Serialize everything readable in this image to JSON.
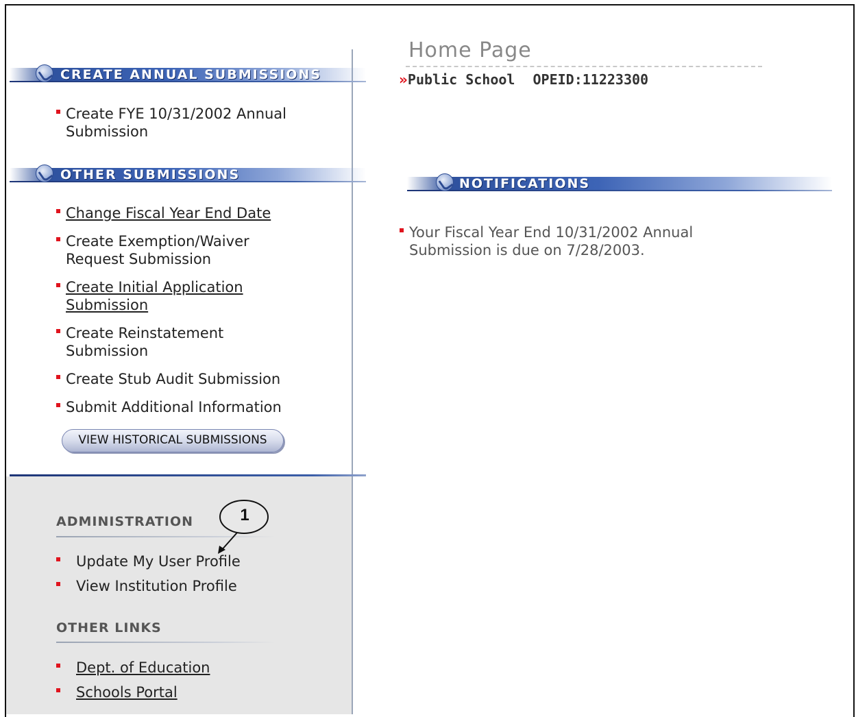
{
  "sidebar": {
    "create_annual": {
      "title": "CREATE ANNUAL SUBMISSIONS",
      "items": [
        {
          "line1": "Create FYE 10/31/2002 Annual",
          "line2": "Submission"
        }
      ]
    },
    "other_submissions": {
      "title": "OTHER SUBMISSIONS",
      "items": [
        {
          "line1": "Change Fiscal Year End Date",
          "line2": ""
        },
        {
          "line1": "Create Exemption/Waiver",
          "line2": "Request Submission"
        },
        {
          "line1": "Create Initial Application",
          "line2": "Submission"
        },
        {
          "line1": "Create Reinstatement",
          "line2": "Submission"
        },
        {
          "line1": "Create Stub Audit Submission",
          "line2": ""
        },
        {
          "line1": "Submit Additional Information",
          "line2": ""
        }
      ],
      "history_button": "VIEW HISTORICAL SUBMISSIONS"
    },
    "administration": {
      "title": "ADMINISTRATION",
      "items": [
        "Update My User Profile",
        "View Institution Profile"
      ]
    },
    "other_links": {
      "title": "OTHER LINKS",
      "items": [
        "Dept. of Education",
        "Schools Portal"
      ]
    }
  },
  "main": {
    "page_title": "Home Page",
    "breadcrumb_marker": "»",
    "institution_name": "Public School",
    "opeid": "OPEID:11223300",
    "notifications_title": "NOTIFICATIONS",
    "notification": {
      "line1": "Your Fiscal Year End 10/31/2002 Annual",
      "line2": "Submission is due on 7/28/2003."
    }
  },
  "callout": {
    "number": "1"
  },
  "colors": {
    "bullet": "#e0141e",
    "banner": "#2a4c97",
    "admin_bg": "#e6e6e6"
  }
}
